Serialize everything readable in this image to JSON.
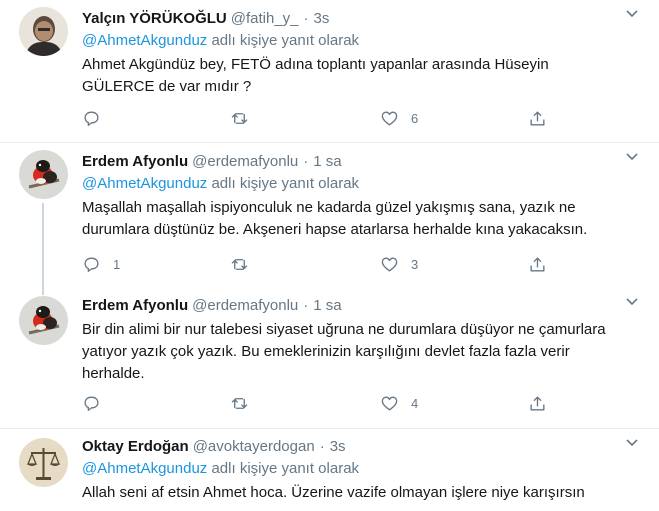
{
  "tweets": [
    {
      "name": "Yalçın YÖRÜKOĞLU",
      "handle": "@fatih_y_",
      "dot": "·",
      "time": "3s",
      "reply_prefix": "@AhmetAkgunduz",
      "reply_suffix": " adlı kişiye yanıt olarak",
      "text": "Ahmet Akgündüz bey, FETÖ adına toplantı yapanlar arasında Hüseyin GÜLERCE de var mıdır ?",
      "replies": "",
      "retweets": "",
      "likes": "6"
    },
    {
      "name": "Erdem Afyonlu",
      "handle": "@erdemafyonlu",
      "dot": "·",
      "time": "1 sa",
      "reply_prefix": "@AhmetAkgunduz",
      "reply_suffix": " adlı kişiye yanıt olarak",
      "text": "Maşallah maşallah ispiyonculuk ne kadarda güzel yakışmış sana, yazık ne durumlara düştünüz be. Akşeneri  hapse atarlarsa herhalde kına yakacaksın.",
      "replies": "1",
      "retweets": "",
      "likes": "3"
    },
    {
      "name": "Erdem Afyonlu",
      "handle": "@erdemafyonlu",
      "dot": "·",
      "time": "1 sa",
      "text": "Bir din alimi  bir nur talebesi siyaset uğruna ne durumlara düşüyor ne çamurlara yatıyor yazık çok yazık. Bu emeklerinizin karşılığını devlet fazla fazla verir herhalde.",
      "replies": "",
      "retweets": "",
      "likes": "4"
    },
    {
      "name": "Oktay Erdoğan",
      "handle": "@avoktayerdogan",
      "dot": "·",
      "time": "3s",
      "reply_prefix": "@AhmetAkgunduz",
      "reply_suffix": " adlı kişiye yanıt olarak",
      "text": "Allah seni af etsin Ahmet hoca. Üzerine vazife olmayan işlere niye karışırsın"
    }
  ],
  "icons": {
    "reply": "reply-icon",
    "retweet": "retweet-icon",
    "like": "heart-icon",
    "share": "share-icon",
    "more": "chevron-down-icon"
  },
  "colors": {
    "mention": "#1b95e0",
    "secondary": "#657786",
    "divider": "#e6ecf0"
  }
}
